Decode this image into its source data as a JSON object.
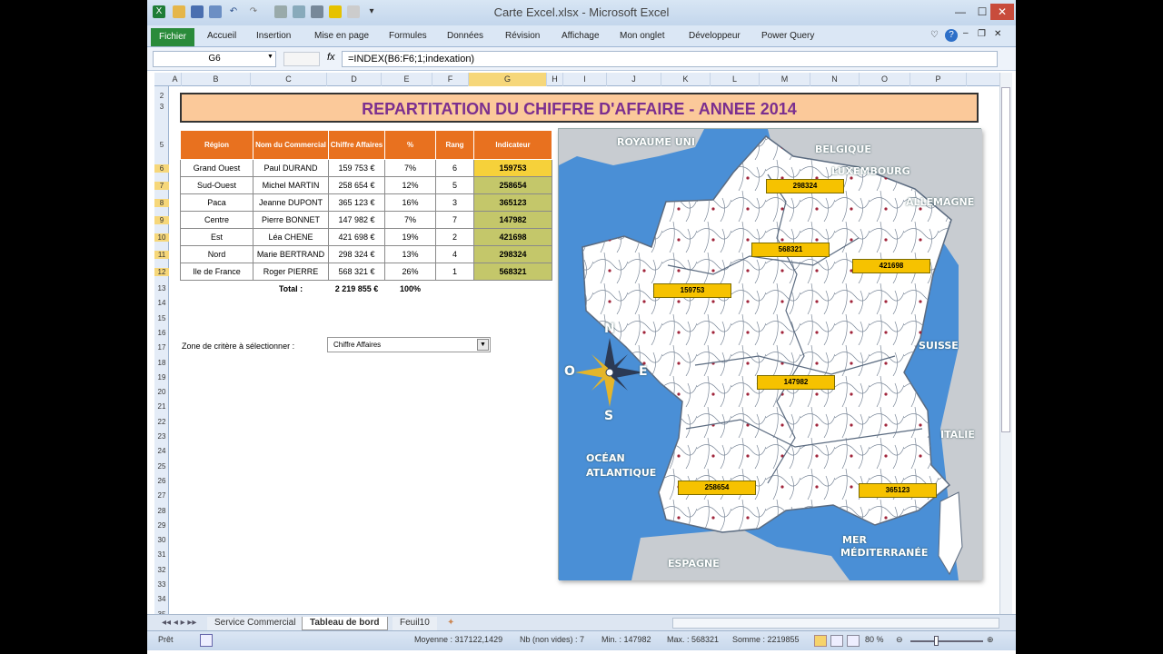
{
  "window": {
    "title": "Carte Excel.xlsx - Microsoft Excel"
  },
  "ribbon": {
    "file_tab": "Fichier",
    "tabs": [
      "Accueil",
      "Insertion",
      "Mise en page",
      "Formules",
      "Données",
      "Révision",
      "Affichage",
      "Mon onglet",
      "Développeur",
      "Power Query"
    ]
  },
  "formula_bar": {
    "name_box": "G6",
    "fx": "fx",
    "formula": "=INDEX(B6:F6;1;indexation)"
  },
  "grid": {
    "columns": [
      "A",
      "B",
      "C",
      "D",
      "E",
      "F",
      "G",
      "H",
      "I",
      "J",
      "K",
      "L",
      "M",
      "N",
      "O",
      "P"
    ],
    "rows": [
      "2",
      "3",
      "5",
      "6",
      "7",
      "8",
      "9",
      "10",
      "11",
      "12",
      "13",
      "14",
      "15",
      "16",
      "17",
      "18",
      "19",
      "20",
      "21",
      "22",
      "23",
      "24",
      "25",
      "26",
      "27",
      "28",
      "29",
      "30",
      "31",
      "32",
      "33",
      "34",
      "35"
    ]
  },
  "banner": {
    "title": "REPARTITATION DU CHIFFRE D'AFFAIRE - ANNEE 2014"
  },
  "table": {
    "headers": [
      "Région",
      "Nom du Commercial",
      "Chiffre Affaires",
      "%",
      "Rang",
      "Indicateur"
    ],
    "rows": [
      [
        "Grand Ouest",
        "Paul DURAND",
        "159 753 €",
        "7%",
        "6",
        "159753"
      ],
      [
        "Sud-Ouest",
        "Michel MARTIN",
        "258 654 €",
        "12%",
        "5",
        "258654"
      ],
      [
        "Paca",
        "Jeanne DUPONT",
        "365 123 €",
        "16%",
        "3",
        "365123"
      ],
      [
        "Centre",
        "Pierre BONNET",
        "147 982 €",
        "7%",
        "7",
        "147982"
      ],
      [
        "Est",
        "Léa CHENE",
        "421 698 €",
        "19%",
        "2",
        "421698"
      ],
      [
        "Nord",
        "Marie BERTRAND",
        "298 324 €",
        "13%",
        "4",
        "298324"
      ],
      [
        "Ile de France",
        "Roger PIERRE",
        "568 321 €",
        "26%",
        "1",
        "568321"
      ]
    ],
    "total_label": "Total :",
    "total_value": "2 219 855 €",
    "total_pct": "100%"
  },
  "criteria": {
    "label": "Zone de critère à sélectionner :",
    "selected": "Chiffre Affaires"
  },
  "map": {
    "labels": {
      "uk": "ROYAUME UNI",
      "be": "BELGIQUE",
      "lu": "LUXEMBOURG",
      "de": "ALLEMAGNE",
      "ch": "SUISSE",
      "it": "ITALIE",
      "es": "ESPAGNE",
      "ocean1": "OCÉAN",
      "ocean2": "ATLANTIQUE",
      "mer1": "MER",
      "mer2": "MÉDITERRANÉE"
    },
    "compass": {
      "n": "N",
      "s": "S",
      "e": "E",
      "o": "O"
    },
    "values": {
      "nord": "298324",
      "idf": "568321",
      "est": "421698",
      "ouest": "159753",
      "centre": "147982",
      "sudouest": "258654",
      "paca": "365123"
    },
    "colors": {
      "sea": "#4a8fd6",
      "land": "#ffffff",
      "border": "#5b6b80",
      "label": "#f6c200"
    }
  },
  "sheets": [
    "Service Commercial",
    "Tableau de bord",
    "Feuil10"
  ],
  "status": {
    "ready": "Prêt",
    "average": "Moyenne : 317122,1429",
    "count": "Nb (non vides) : 7",
    "min": "Min. : 147982",
    "max": "Max. : 568321",
    "sum": "Somme : 2219855",
    "zoom": "80 %"
  }
}
